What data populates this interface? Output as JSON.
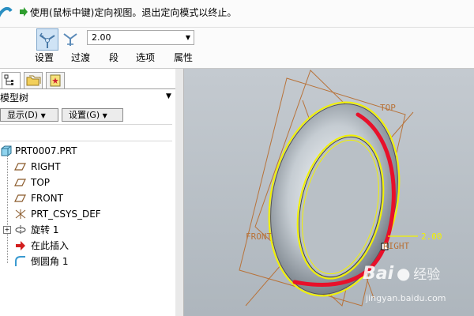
{
  "message": {
    "text": "使用(鼠标中键)定向视图。退出定向模式以终止。"
  },
  "orient_toolbar": {
    "value": "2.00",
    "tabs": [
      "设置",
      "过渡",
      "段",
      "选项",
      "属性"
    ]
  },
  "left_panel": {
    "tree_title": "模型树",
    "show_button": "显示(D)",
    "settings_button": "设置(G)",
    "tree_items": [
      {
        "label": "PRT0007.PRT",
        "icon": "part-icon"
      },
      {
        "label": "RIGHT",
        "icon": "datum-plane-icon"
      },
      {
        "label": "TOP",
        "icon": "datum-plane-icon"
      },
      {
        "label": "FRONT",
        "icon": "datum-plane-icon"
      },
      {
        "label": "PRT_CSYS_DEF",
        "icon": "coordinate-system-icon"
      },
      {
        "label": "旋转 1",
        "icon": "revolve-icon"
      },
      {
        "label": "在此插入",
        "icon": "insert-here-arrow-icon"
      },
      {
        "label": "倒圆角 1",
        "icon": "round-icon"
      }
    ]
  },
  "viewport": {
    "plane_labels": [
      "TOP",
      "FRONT",
      "RIGHT"
    ],
    "dimension_value": "2.00",
    "highlight_color": "#e8102a",
    "edge_color": "#f2f200",
    "datum_color": "#b8733a"
  },
  "watermark": {
    "brand": "Bai",
    "brand_suffix": "经验",
    "url": "jingyan.baidu.com"
  }
}
